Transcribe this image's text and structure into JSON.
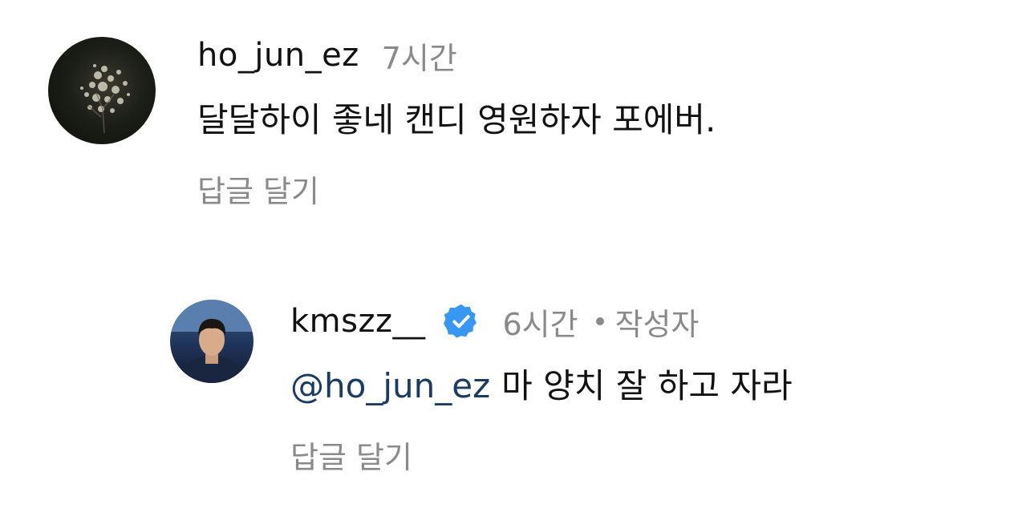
{
  "comments": [
    {
      "username": "ho_jun_ez",
      "time": "7시간",
      "text": "달달하이 좋네 캔디 영원하자 포에버.",
      "reply_label": "답글 달기"
    },
    {
      "username": "kmszz__",
      "verified": true,
      "time": "6시간",
      "author_tag": "작성자",
      "mention": "@ho_jun_ez",
      "text": "마 양치 잘 하고 자라",
      "reply_label": "답글 달기"
    }
  ],
  "colors": {
    "text": "#111111",
    "secondary": "#8a8a8a",
    "mention": "#1b3b63",
    "verified_badge": "#3897f0"
  }
}
